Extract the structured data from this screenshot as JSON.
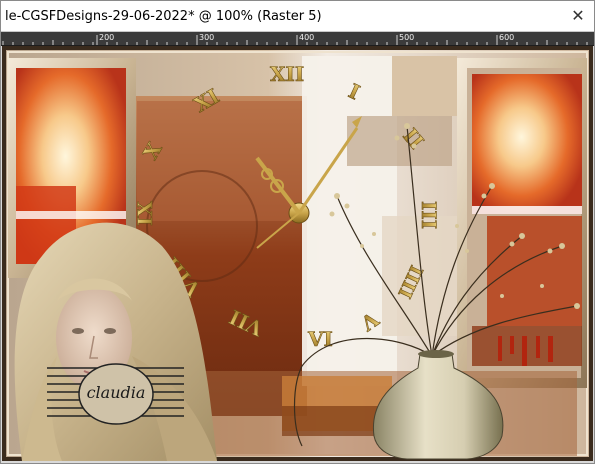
{
  "window": {
    "title": "le-CGSFDesigns-29-06-2022* @ 100% (Raster 5)",
    "close_glyph": "✕"
  },
  "ruler": {
    "labels": [
      "200",
      "300",
      "400",
      "500",
      "600"
    ]
  },
  "canvas": {
    "clock_numerals": [
      "XII",
      "I",
      "II",
      "III",
      "IIII",
      "V",
      "VI",
      "VII",
      "VIII",
      "IX",
      "X",
      "XI"
    ],
    "watermark_text": "claudia"
  },
  "colors": {
    "ruler_bg": "#3b3b3b",
    "ruler_text": "#f0f0f0",
    "title_bg": "#ffffff",
    "gold": "#c9a54a",
    "rust": "#9a3a12"
  },
  "icons": {
    "close": "close-icon"
  }
}
